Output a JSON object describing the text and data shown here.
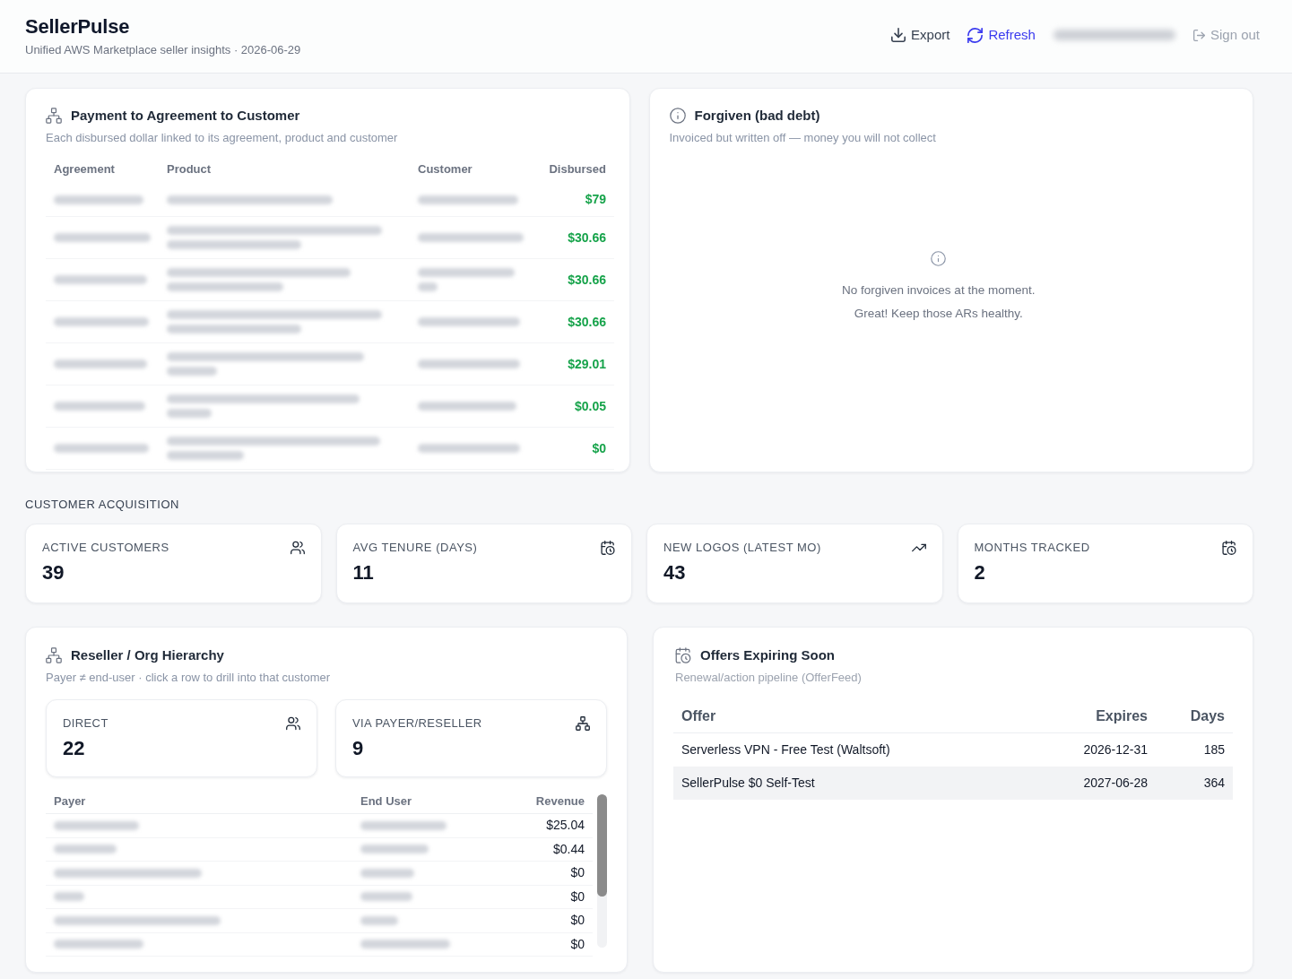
{
  "header": {
    "title": "SellerPulse",
    "subtitle": "Unified AWS Marketplace seller insights · 2026-06-29",
    "actions": [
      {
        "kind": "export",
        "label": "Export"
      },
      {
        "kind": "refresh",
        "label": "Refresh"
      },
      {
        "kind": "account",
        "redacted": true
      },
      {
        "kind": "signout",
        "label": "Sign out"
      }
    ]
  },
  "payment_card": {
    "title": "Payment to Agreement to Customer",
    "subtitle": "Each disbursed dollar linked to its agreement, product and customer",
    "table": {
      "columns": [
        "Agreement",
        "Product",
        "Customer",
        "Disbursed"
      ],
      "rows": [
        {
          "agreement": {
            "redacted": true
          },
          "product": {
            "redacted": true,
            "wrapped": false
          },
          "customer": {
            "redacted": true,
            "wrapped": false
          },
          "disbursed": "$79"
        },
        {
          "agreement": {
            "redacted": true
          },
          "product": {
            "redacted": true,
            "wrapped": true
          },
          "customer": {
            "redacted": true,
            "wrapped": false
          },
          "disbursed": "$30.66"
        },
        {
          "agreement": {
            "redacted": true
          },
          "product": {
            "redacted": true,
            "wrapped": true
          },
          "customer": {
            "redacted": true,
            "wrapped": true
          },
          "disbursed": "$30.66"
        },
        {
          "agreement": {
            "redacted": true
          },
          "product": {
            "redacted": true,
            "wrapped": true
          },
          "customer": {
            "redacted": true,
            "wrapped": false
          },
          "disbursed": "$30.66"
        },
        {
          "agreement": {
            "redacted": true
          },
          "product": {
            "redacted": true,
            "wrapped": true
          },
          "customer": {
            "redacted": true,
            "wrapped": false
          },
          "disbursed": "$29.01"
        },
        {
          "agreement": {
            "redacted": true
          },
          "product": {
            "redacted": true,
            "wrapped": true
          },
          "customer": {
            "redacted": true,
            "wrapped": false
          },
          "disbursed": "$0.05"
        },
        {
          "agreement": {
            "redacted": true
          },
          "product": {
            "redacted": true,
            "wrapped": true
          },
          "customer": {
            "redacted": true,
            "wrapped": false
          },
          "disbursed": "$0"
        }
      ]
    }
  },
  "forgiven_card": {
    "title": "Forgiven (bad debt)",
    "subtitle": "Invoiced but written off — money you will not collect",
    "empty_state": {
      "lines": [
        "No forgiven invoices at the moment.",
        "Great! Keep those ARs healthy."
      ]
    }
  },
  "customer_acquisition": {
    "heading": "CUSTOMER ACQUISITION",
    "kpis": [
      {
        "kind": "users",
        "label": "ACTIVE CUSTOMERS",
        "value": "39"
      },
      {
        "kind": "calendar",
        "label": "AVG TENURE (DAYS)",
        "value": "11"
      },
      {
        "kind": "trend",
        "label": "NEW LOGOS (LATEST MO)",
        "value": "43"
      },
      {
        "kind": "calendar",
        "label": "MONTHS TRACKED",
        "value": "2"
      }
    ]
  },
  "reseller_card": {
    "title": "Reseller / Org Hierarchy",
    "subtitle": "Payer ≠ end-user · click a row to drill into that customer",
    "stats": [
      {
        "kind": "users",
        "label": "DIRECT",
        "value": "22"
      },
      {
        "kind": "hierarchy",
        "label": "VIA PAYER/RESELLER",
        "value": "9"
      }
    ],
    "table": {
      "columns": [
        "Payer",
        "End User",
        "Revenue"
      ],
      "rows": [
        {
          "payer": {
            "redacted": true
          },
          "end_user": {
            "redacted": true
          },
          "revenue": "$25.04"
        },
        {
          "payer": {
            "redacted": true
          },
          "end_user": {
            "redacted": true
          },
          "revenue": "$0.44"
        },
        {
          "payer": {
            "redacted": true
          },
          "end_user": {
            "redacted": true
          },
          "revenue": "$0"
        },
        {
          "payer": {
            "redacted": true
          },
          "end_user": {
            "redacted": true
          },
          "revenue": "$0"
        },
        {
          "payer": {
            "redacted": true
          },
          "end_user": {
            "redacted": true
          },
          "revenue": "$0"
        },
        {
          "payer": {
            "redacted": true
          },
          "end_user": {
            "redacted": true
          },
          "revenue": "$0"
        }
      ]
    }
  },
  "offers_card": {
    "title": "Offers Expiring Soon",
    "subtitle": "Renewal/action pipeline (OfferFeed)",
    "table": {
      "columns": [
        "Offer",
        "Expires",
        "Days"
      ],
      "rows": [
        {
          "offer": "Serverless VPN - Free Test (Waltsoft)",
          "expires": "2026-12-31",
          "days": "185",
          "highlighted": false
        },
        {
          "offer": "SellerPulse $0 Self-Test",
          "expires": "2027-06-28",
          "days": "364",
          "highlighted": true
        }
      ]
    }
  }
}
